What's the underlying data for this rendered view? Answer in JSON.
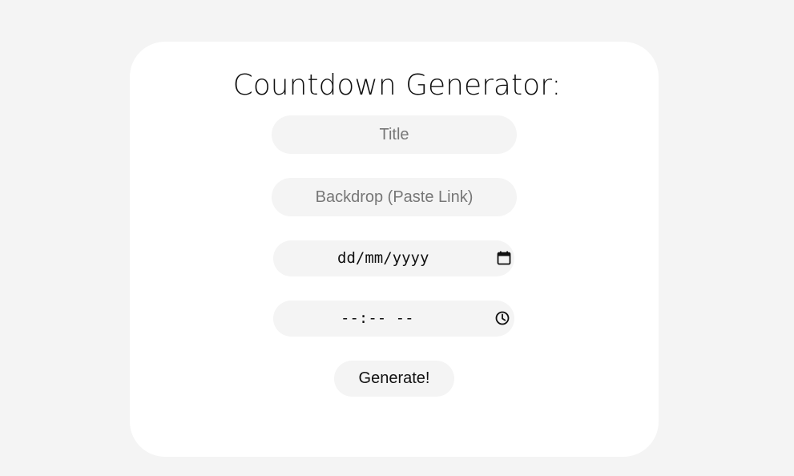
{
  "heading": "Countdown Generator:",
  "form": {
    "title_placeholder": "Title",
    "backdrop_placeholder": "Backdrop (Paste Link)",
    "date_value": "dd/mm/yyyy",
    "date_icon": "calendar-icon",
    "time_value": "--:-- --",
    "time_icon": "clock-icon",
    "generate_label": "Generate!"
  },
  "colors": {
    "page_background": "#f4f4f4",
    "card_background": "#ffffff",
    "field_background": "#f4f4f4",
    "placeholder_text": "#777777",
    "text": "#111111"
  }
}
